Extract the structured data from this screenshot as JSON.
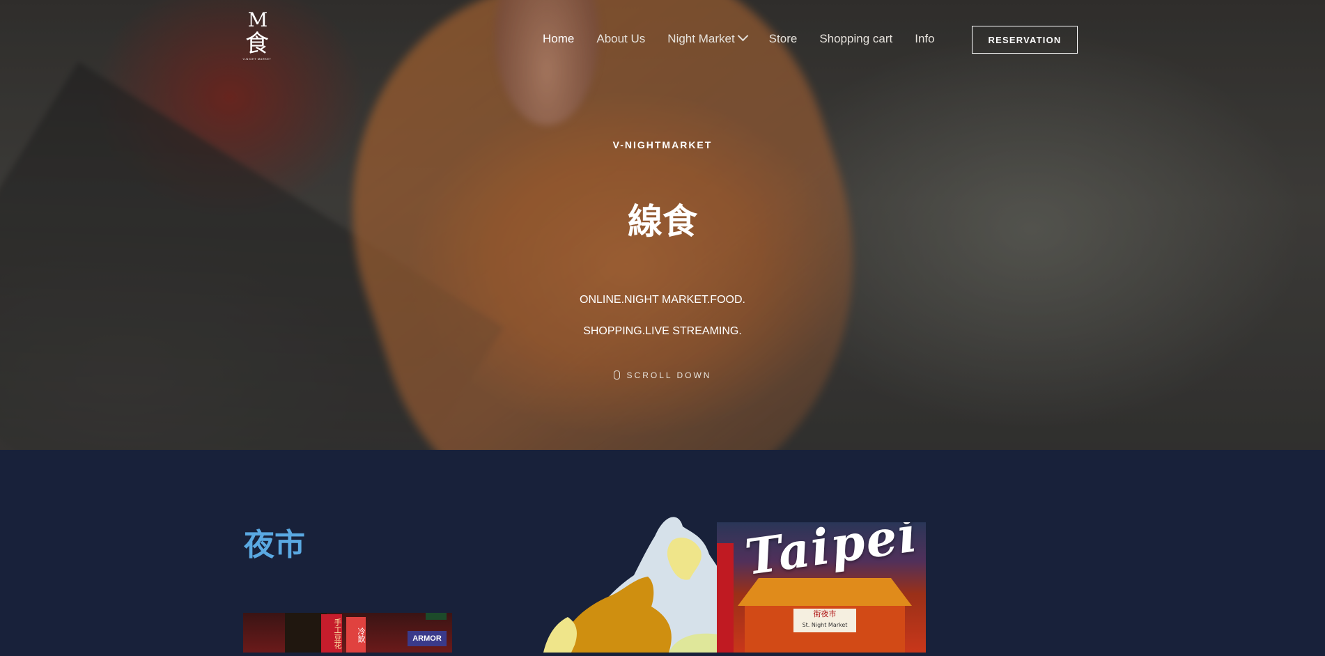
{
  "nav": {
    "logo_mark": "M",
    "logo_char": "食",
    "logo_sub": "V-NIGHT MARKET",
    "items": [
      {
        "label": "Home",
        "active": true
      },
      {
        "label": "About Us",
        "active": false
      },
      {
        "label": "Night Market",
        "active": false,
        "has_dropdown": true
      },
      {
        "label": "Store",
        "active": false
      },
      {
        "label": "Shopping cart",
        "active": false
      },
      {
        "label": "Info",
        "active": false
      }
    ],
    "cta": "RESERVATION"
  },
  "hero": {
    "kicker": "V-NIGHTMARKET",
    "title": "線食",
    "tagline_1": "ONLINE.NIGHT MARKET.FOOD.",
    "tagline_2": "SHOPPING.LIVE STREAMING.",
    "scroll_label": "SCROLL DOWN",
    "scroll_icon": "mouse-icon"
  },
  "section": {
    "heading": "夜市",
    "heading_color": "#5aa9e2",
    "map_label": "taiwan-map",
    "card_word": "Taipei",
    "card_sign": "街夜市",
    "card_sign_en": "St. Night Market",
    "thumb_sign_1": "手工豆花",
    "thumb_sign_2": "冷飲",
    "thumb_sign_3": "ARMOR"
  },
  "colors": {
    "background": "#18213a",
    "accent": "#5aa9e2",
    "map_gold": "#cf8f10",
    "map_pale": "#d6e1ea",
    "map_yellow": "#efe58a"
  }
}
